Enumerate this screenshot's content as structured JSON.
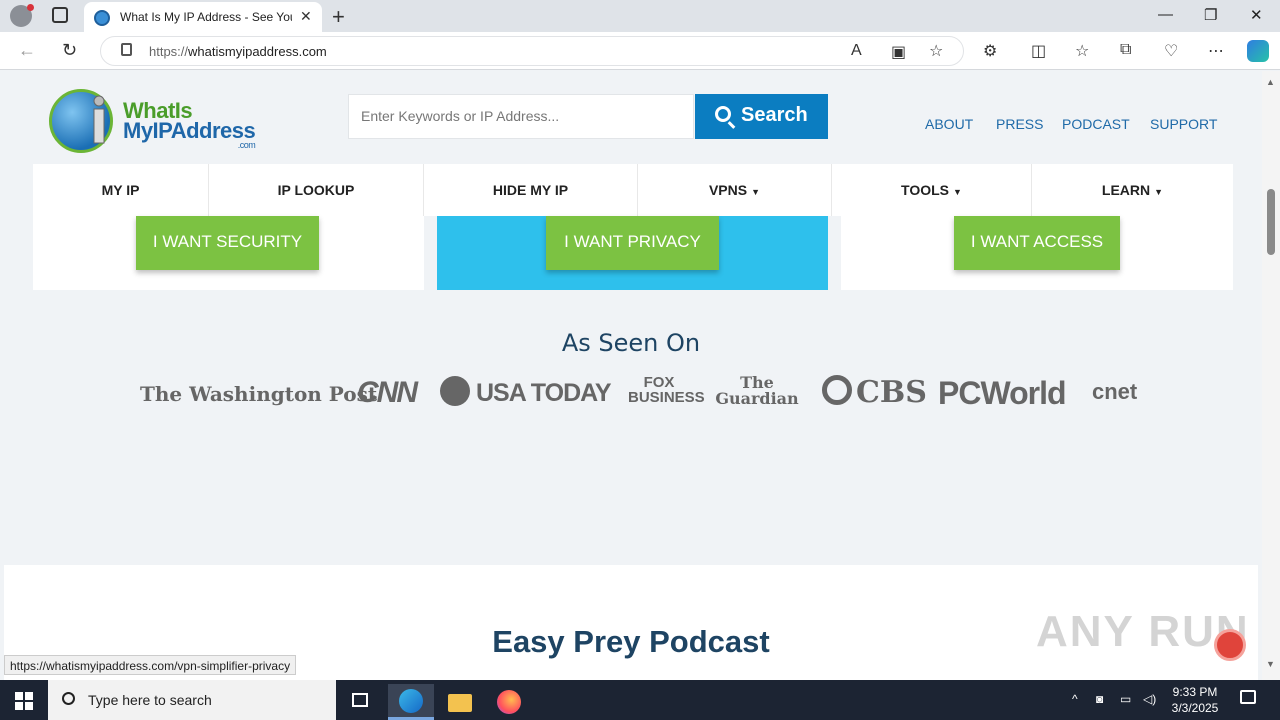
{
  "browser": {
    "tab_title": "What Is My IP Address - See Your",
    "url_prefix": "https://",
    "url_host": "whatismyipaddress.com",
    "window_controls": {
      "minimize": "—",
      "restore": "❐",
      "close": "✕"
    },
    "status_url": "https://whatismyipaddress.com/vpn-simplifier-privacy"
  },
  "site": {
    "logo_line1": "WhatIs",
    "logo_line2": "MyIPAddress",
    "logo_com": ".com",
    "search_placeholder": "Enter Keywords or IP Address...",
    "search_button": "Search",
    "top_links": [
      "ABOUT",
      "PRESS",
      "PODCAST",
      "SUPPORT"
    ],
    "nav": [
      {
        "label": "MY IP",
        "caret": ""
      },
      {
        "label": "IP LOOKUP",
        "caret": ""
      },
      {
        "label": "HIDE MY IP",
        "caret": ""
      },
      {
        "label": "VPNS",
        "caret": "▼"
      },
      {
        "label": "TOOLS",
        "caret": "▼"
      },
      {
        "label": "LEARN",
        "caret": "▼"
      }
    ],
    "cta": [
      "I WANT SECURITY",
      "I WANT PRIVACY",
      "I WANT ACCESS"
    ],
    "seen_title": "As Seen On",
    "press_logos": [
      "The Washington Post",
      "CNN",
      "USA TODAY",
      "FOX BUSINESS",
      "The Guardian",
      "CBS",
      "PCWorld",
      "cnet"
    ],
    "podcast_title": "Easy Prey Podcast",
    "watermark": "ANY RUN"
  },
  "taskbar": {
    "search_text": "Type here to search",
    "time": "9:33 PM",
    "date": "3/3/2025"
  },
  "colors": {
    "search_blue": "#0b7dc1",
    "cta_green": "#7cc242",
    "privacy_card": "#2ec0ec",
    "nav_link": "#1f6aa8",
    "heading": "#1e4463"
  }
}
